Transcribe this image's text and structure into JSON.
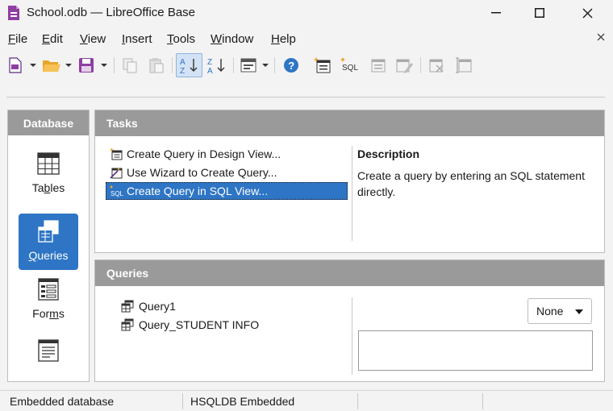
{
  "window": {
    "title": "School.odb — LibreOffice Base",
    "app_icon": "libreoffice-base-icon"
  },
  "menubar": {
    "items": [
      {
        "label": "File",
        "mnemonic": "F"
      },
      {
        "label": "Edit",
        "mnemonic": "E"
      },
      {
        "label": "View",
        "mnemonic": "V"
      },
      {
        "label": "Insert",
        "mnemonic": "I"
      },
      {
        "label": "Tools",
        "mnemonic": "T"
      },
      {
        "label": "Window",
        "mnemonic": "W"
      },
      {
        "label": "Help",
        "mnemonic": "H"
      }
    ]
  },
  "toolbar": {
    "buttons": [
      "new-icon",
      "open-icon",
      "save-icon",
      "copy-icon",
      "paste-icon",
      "sort-ascending-icon",
      "sort-descending-icon",
      "form-view-icon",
      "help-icon",
      "create-query-design-icon",
      "create-query-sql-icon",
      "edit-query-icon",
      "edit-query-sql-icon",
      "delete-query-icon",
      "rename-query-icon"
    ],
    "sql_label": "SQL"
  },
  "database_panel": {
    "header": "Database",
    "items": [
      {
        "label": "Tables",
        "mnemonic": "b"
      },
      {
        "label": "Queries",
        "mnemonic": "Q",
        "selected": true
      },
      {
        "label": "Forms",
        "mnemonic": "m"
      },
      {
        "label": "Reports"
      }
    ]
  },
  "tasks_panel": {
    "header": "Tasks",
    "tasks": [
      {
        "label": "Create Query in Design View..."
      },
      {
        "label": "Use Wizard to Create Query..."
      },
      {
        "label": "Create Query in SQL View...",
        "selected": true
      }
    ],
    "description_title": "Description",
    "description_text": "Create a query by entering an SQL statement directly."
  },
  "queries_panel": {
    "header": "Queries",
    "queries": [
      "Query1",
      "Query_STUDENT INFO"
    ],
    "preview_select": "None"
  },
  "statusbar": {
    "connection": "Embedded database",
    "engine": "HSQLDB Embedded"
  },
  "colors": {
    "accent": "#2e75c5",
    "panel_header": "#9a9a9a"
  }
}
